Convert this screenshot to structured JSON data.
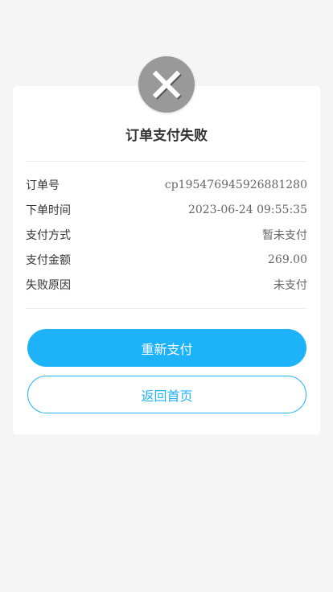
{
  "result": {
    "icon": "close-icon",
    "title": "订单支付失败"
  },
  "order_info": [
    {
      "label": "订单号",
      "value": "cp195476945926881280"
    },
    {
      "label": "下单时间",
      "value": "2023-06-24 09:55:35"
    },
    {
      "label": "支付方式",
      "value": "暂未支付"
    },
    {
      "label": "支付金额",
      "value": "269.00"
    },
    {
      "label": "失败原因",
      "value": "未支付"
    }
  ],
  "actions": {
    "retry_label": "重新支付",
    "home_label": "返回首页"
  },
  "colors": {
    "accent": "#1eb2f8",
    "badge": "#999999",
    "background": "#f5f5f5"
  }
}
